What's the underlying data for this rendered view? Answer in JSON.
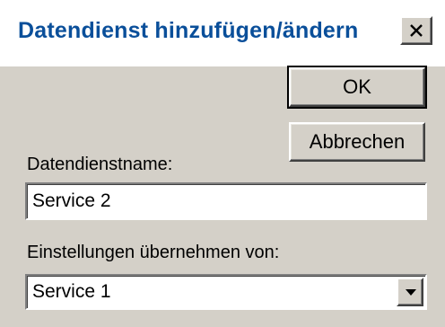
{
  "window": {
    "title": "Datendienst hinzufügen/ändern",
    "close_icon": "close-icon",
    "title_color": "#0a4f9a"
  },
  "buttons": {
    "ok_label": "OK",
    "cancel_label": "Abbrechen"
  },
  "form": {
    "service_name_label": "Datendienstname:",
    "service_name_value": "Service 2",
    "settings_label": "Einstellungen übernehmen von:",
    "settings_selected": "Service 1",
    "settings_arrow_icon": "dropdown-arrow-icon"
  }
}
